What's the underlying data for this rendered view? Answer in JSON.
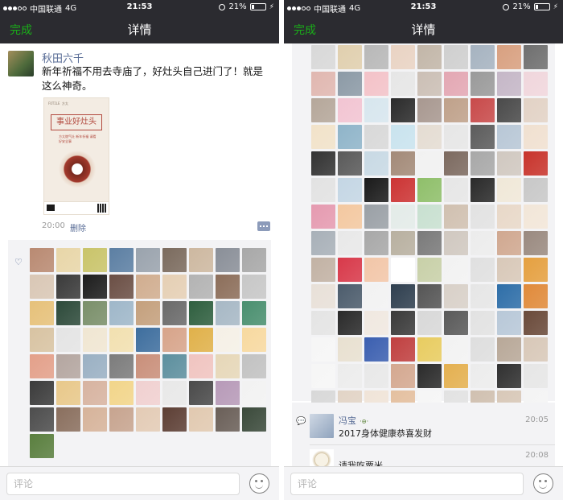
{
  "status_bar": {
    "carrier": "中国联通",
    "network": "4G",
    "time": "21:53",
    "battery": "21%",
    "battery_level": 0.21
  },
  "nav": {
    "done_label": "完成",
    "title": "详情"
  },
  "post": {
    "author": "秋田六千",
    "text": "新年祈福不用去寺庙了，好灶头自己进门了！就是这么神奇。",
    "image": {
      "brand": "FOTILE 方太",
      "headline": "事业好灶头",
      "subtitle": "方太燃气灶 新年祈福 请看好安全事"
    },
    "time": "20:00",
    "delete_label": "删除"
  },
  "likes": {
    "left_avatar_colors": [
      "#b98a72",
      "#e8d6a8",
      "#c9c46a",
      "#5c7fa3",
      "#9aa3ad",
      "#7b6b5e",
      "#cdb8a0",
      "#8a8f98",
      "#a8a8a8",
      "#d9c7b5",
      "#3a3a3a",
      "#1d1d1d",
      "#6b4f45",
      "#d0ad8f",
      "#e5cfb4",
      "#b3b3b3",
      "#8c6e5a",
      "#c7c7c7",
      "#e6c17a",
      "#2d4a3a",
      "#7a8f6a",
      "#9fb7c9",
      "#c4a07d",
      "#6a6a6a",
      "#2f5f3f",
      "#a7b8c5",
      "#4a8f6f",
      "#d8c3a2",
      "#e4e4e4",
      "#f0e6d2",
      "#f2e0b0",
      "#3e6e9e",
      "#d7a48a",
      "#e0b14a",
      "#f5f0e6",
      "#f7d9a0",
      "#e3a08a",
      "#b4a6a0",
      "#9ab0c3",
      "#7c7c7c",
      "#c98f7a",
      "#5d8f9e",
      "#f0c4c0",
      "#e6d7b8",
      "#c2c2c2",
      "#3b3b3b",
      "#e8c88a",
      "#d7b3a0",
      "#f2d58a",
      "#f0d0d0",
      "#e8e8e8",
      "#4a4a4a",
      "#b79ab8",
      "#f2f2f2",
      "#4d4d4d",
      "#8a6f5e",
      "#d6b39a",
      "#c7a48f",
      "#e3cbb5",
      "#5d3f35",
      "#e1c9b0",
      "#6a5f58",
      "#3b4a3b",
      "#5a7f3f"
    ],
    "right_avatar_colors": [
      "#d8d8d8",
      "#e0cfae",
      "#b8b8b8",
      "#e9d3c3",
      "#c2b6a8",
      "#cfcfcf",
      "#a6b3c0",
      "#d8a080",
      "#6f6f6f",
      "#e0b7b0",
      "#8c9aa6",
      "#f3c2c8",
      "#e6e6e6",
      "#cbbfb5",
      "#e3a7b3",
      "#9a9a9a",
      "#c5b7c7",
      "#f0d6dc",
      "#b5a79a",
      "#f2c4d2",
      "#d7e6ee",
      "#2b2b2b",
      "#a89890",
      "#bfa18a",
      "#c84a4a",
      "#4a4a4a",
      "#e2d2c5",
      "#f1e2c9",
      "#8fb4c9",
      "#d8d8d8",
      "#c9e3ee",
      "#e4dcd2",
      "#e6e6e6",
      "#5c5c5c",
      "#b8c7d6",
      "#f0e0d0",
      "#333333",
      "#5a5a5a",
      "#c8d9e4",
      "#a38a78",
      "#f1f1f1",
      "#7c6a60",
      "#a8a8a8",
      "#d0c8c0",
      "#c8342c",
      "#e2e2e2",
      "#c4d6e4",
      "#1a1a1a",
      "#cc3434",
      "#8fbf6a",
      "#e6e6e6",
      "#2a2a2a",
      "#f0e8d8",
      "#c8c8c8",
      "#e59ab0",
      "#f3c8a0",
      "#9aa0a6",
      "#e3ebe8",
      "#c8e0d0",
      "#d0c0b0",
      "#e2e2e2",
      "#e8d8c8",
      "#f2e6d8",
      "#a8b0b8",
      "#e8e8e8",
      "#a8a8a8",
      "#b8b0a0",
      "#7a7a7a",
      "#d0c8c0",
      "#ececec",
      "#d0a890",
      "#9a8a80",
      "#c2b2a4",
      "#d8394a",
      "#f2c6a8",
      "#ffffff",
      "#c8d0a8",
      "#f2f2f2",
      "#e0e0e0",
      "#d8c8b8",
      "#e5a040",
      "#e8e0d8",
      "#4c5c6c",
      "#f2f2f2",
      "#2f3f4f",
      "#555555",
      "#d8d0c8",
      "#e6e6e6",
      "#2e6ea8",
      "#e08a3a",
      "#e4e4e4",
      "#2a2a2a",
      "#f0e8e0",
      "#3a3a3a",
      "#d8d8d8",
      "#5a5a5a",
      "#e2e2e2",
      "#b8c8d8",
      "#6a4a3a",
      "#f6f6f6",
      "#e8e0d0",
      "#3b5fb0",
      "#c04040",
      "#e8cc60",
      "#f2f2f2",
      "#dedede",
      "#b8a898",
      "#d8c8b8",
      "#f6f6f6",
      "#ececec",
      "#e8e8e8",
      "#d4a890",
      "#2a2a2a",
      "#e4b050",
      "#ececec",
      "#303030",
      "#e6e6e6",
      "#d8d8d8",
      "#e2d4c6",
      "#f0e4d8",
      "#e4c0a0",
      "#f6f6f6",
      "#e2e2e2",
      "#d0c0b0",
      "#d8c8b8",
      "#f4f4f4",
      "#ffffff",
      "#b08070",
      "#f0e4d0",
      "#f2f2f2",
      "#e0e0e0"
    ]
  },
  "comments": [
    {
      "author": "冯宝",
      "emoji": "·ө·",
      "text": "2017身体健康恭喜发财",
      "time": "20:05"
    },
    {
      "text": "请我吃粟米",
      "time": "20:08"
    }
  ],
  "comment_input": {
    "placeholder": "评论"
  },
  "icons": {
    "like": "heart-icon",
    "comment": "comment-icon",
    "emoji": "emoji-face-icon"
  },
  "colors": {
    "bar_bg": "#2b2b30",
    "done_green": "#1aad19",
    "link_blue": "#576b95",
    "likes_bg": "#f3f3f5"
  }
}
